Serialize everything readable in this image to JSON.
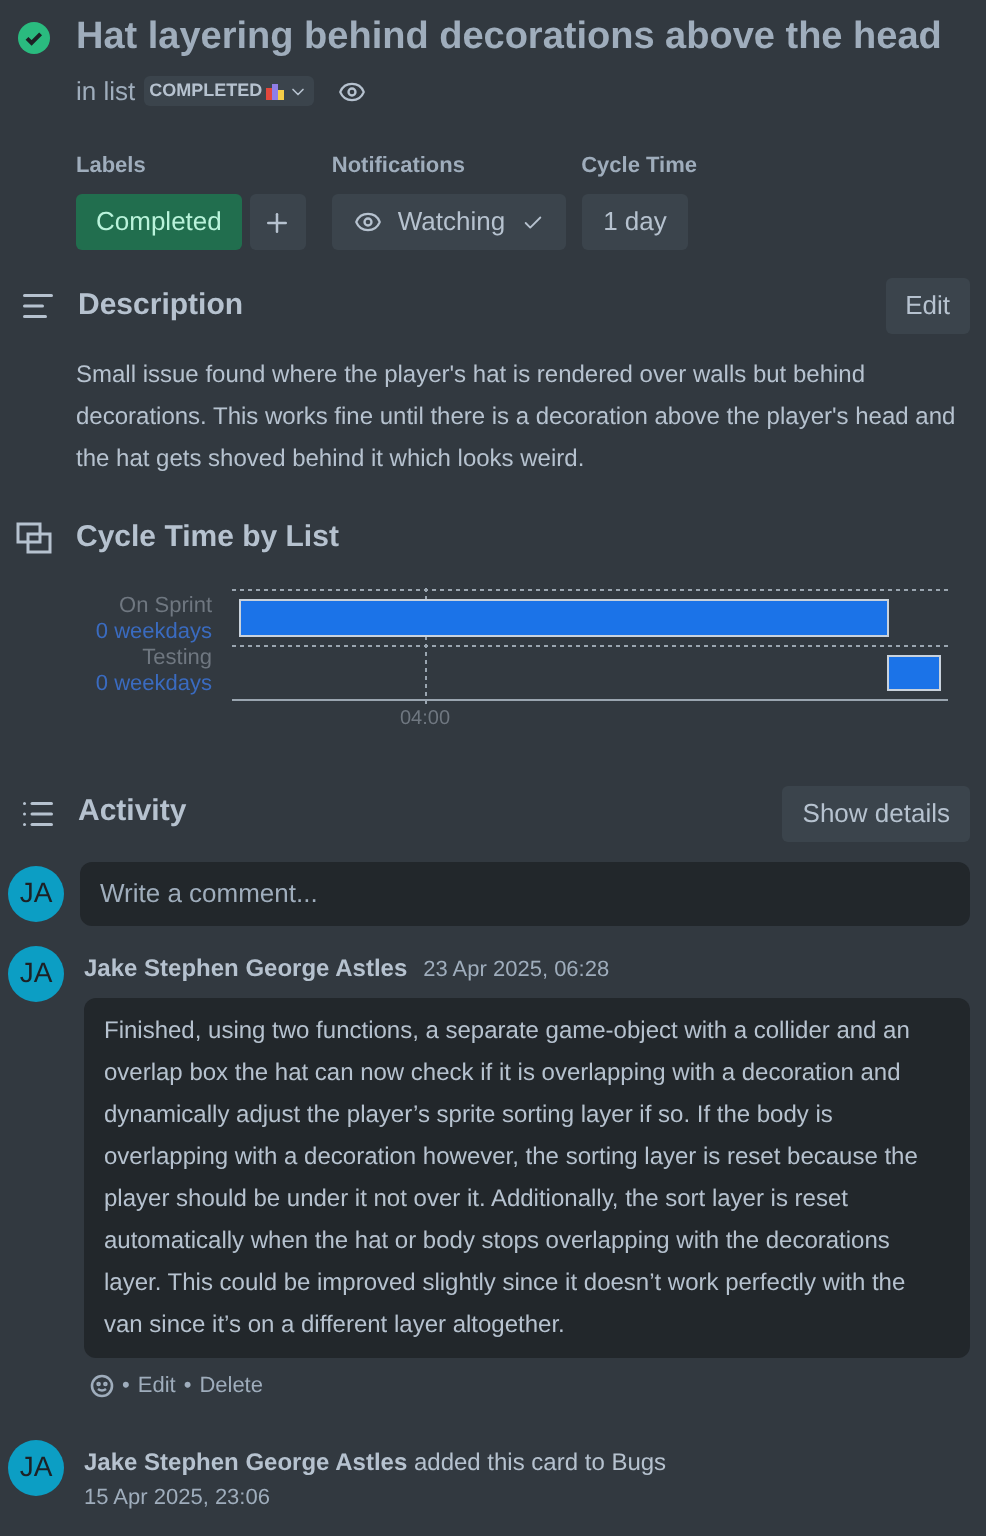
{
  "card": {
    "title": "Hat layering behind decorations above the head",
    "complete": true,
    "list_prefix": "in list",
    "list_name": "COMPLETED"
  },
  "fields": {
    "labels": {
      "heading": "Labels",
      "items": [
        {
          "text": "Completed",
          "color": "#216e4e"
        }
      ]
    },
    "notifications": {
      "heading": "Notifications",
      "button": "Watching",
      "watching": true
    },
    "cycle_time": {
      "heading": "Cycle Time",
      "value": "1 day"
    }
  },
  "description": {
    "heading": "Description",
    "edit_button": "Edit",
    "text": "Small issue found where the player's hat is rendered over walls but behind decorations. This works fine until there is a decoration above the player's head and the hat gets shoved behind it which looks weird."
  },
  "cycle_chart": {
    "heading": "Cycle Time by List",
    "rows": [
      {
        "name": "On Sprint",
        "duration": "0 weekdays"
      },
      {
        "name": "Testing",
        "duration": "0 weekdays"
      }
    ],
    "tick": "04:00"
  },
  "activity": {
    "heading": "Activity",
    "details_button": "Show details",
    "composer_initials": "JA",
    "comment_placeholder": "Write a comment...",
    "entries": [
      {
        "kind": "comment",
        "initials": "JA",
        "author": "Jake Stephen George Astles",
        "time": "23 Apr 2025, 06:28",
        "text": "Finished, using two functions, a separate game-object with a collider and an overlap box the hat can now check if it is overlapping with a decoration and dynamically adjust the player’s sprite sorting layer if so. If the body is overlapping with a decoration however, the sorting layer is reset because the player should be under it not over it. Additionally, the sort layer is reset automatically when the hat or body stops overlapping with the decorations layer. This could be improved slightly since it doesn’t work perfectly with the van since it’s on a different layer altogether.",
        "actions": [
          {
            "separator": "•",
            "label": "Edit"
          },
          {
            "separator": "•",
            "label": "Delete"
          }
        ]
      },
      {
        "kind": "event",
        "initials": "JA",
        "author": "Jake Stephen George Astles",
        "text": "added this card to Bugs",
        "time": "15 Apr 2025, 23:06"
      }
    ]
  }
}
